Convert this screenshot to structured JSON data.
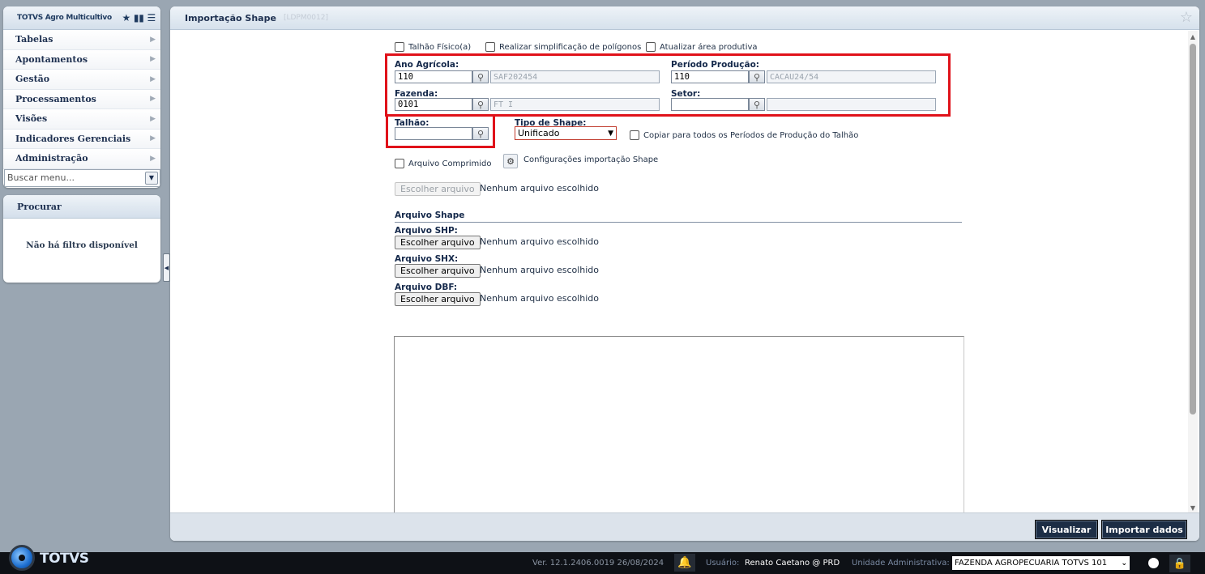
{
  "menu": {
    "app_title": "TOTVS Agro Multicultivo",
    "items": [
      {
        "label": "Tabelas"
      },
      {
        "label": "Apontamentos"
      },
      {
        "label": "Gestão"
      },
      {
        "label": "Processamentos"
      },
      {
        "label": "Visões"
      },
      {
        "label": "Indicadores Gerenciais"
      },
      {
        "label": "Administração"
      }
    ],
    "search_placeholder": "Buscar menu..."
  },
  "search_panel": {
    "title": "Procurar",
    "empty_message": "Não há filtro disponível"
  },
  "main": {
    "title": "Importação Shape",
    "code": "[LDPM0012]"
  },
  "form": {
    "chk_talhao_fisico": "Talhão Físico(a)",
    "chk_simplificacao": "Realizar simplificação de polígonos",
    "chk_area_produtiva": "Atualizar área produtiva",
    "ano_agricola": {
      "label": "Ano Agrícola:",
      "code": "110",
      "description": "SAF202454"
    },
    "periodo_producao": {
      "label": "Período Produção:",
      "code": "110",
      "description": "CACAU24/54"
    },
    "fazenda": {
      "label": "Fazenda:",
      "code": "0101",
      "description": "FT I"
    },
    "setor": {
      "label": "Setor:",
      "code": "",
      "description": ""
    },
    "talhao": {
      "label": "Talhão:",
      "code": ""
    },
    "tipo_shape": {
      "label": "Tipo de Shape:",
      "value": "Unificado"
    },
    "chk_copiar": "Copiar para todos os Períodos de Produção do Talhão",
    "chk_arquivo_comprimido": "Arquivo Comprimido",
    "config_label": "Configurações importação Shape",
    "file_button": "Escolher arquivo",
    "no_file": "Nenhum arquivo escolhido",
    "section_title": "Arquivo Shape",
    "shp_label": "Arquivo SHP:",
    "shx_label": "Arquivo SHX:",
    "dbf_label": "Arquivo DBF:"
  },
  "footer": {
    "visualizar": "Visualizar",
    "importar": "Importar dados"
  },
  "status_bar": {
    "logo": "TOTVS",
    "version": "Ver. 12.1.2406.0019 26/08/2024",
    "user_label": "Usuário:",
    "user": "Renato Caetano @ PRD",
    "unit_label": "Unidade Administrativa:",
    "unit": "FAZENDA AGROPECUARIA TOTVS 101"
  }
}
